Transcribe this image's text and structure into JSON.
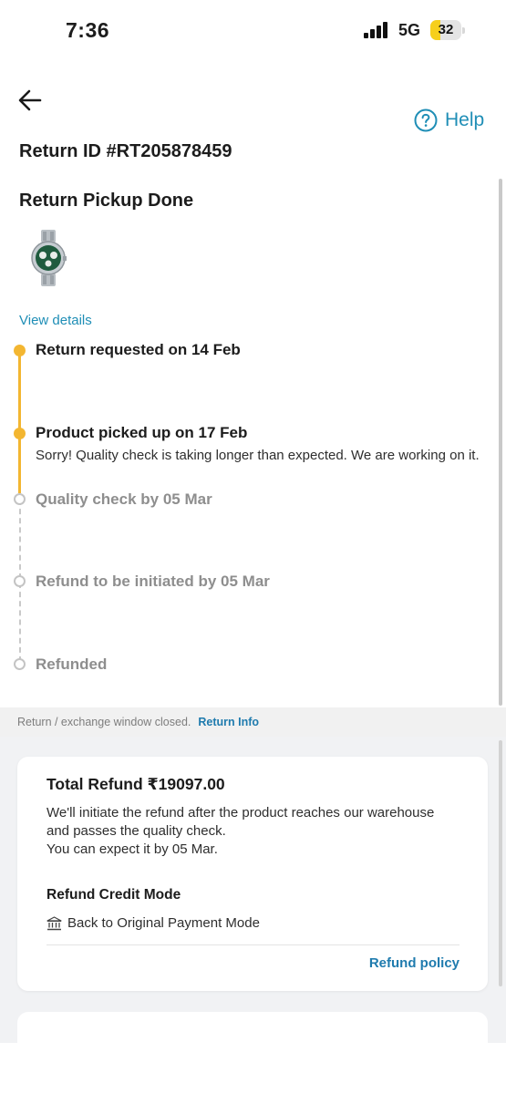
{
  "status_bar": {
    "time": "7:36",
    "network": "5G",
    "battery_level": "32",
    "battery_fraction": 0.32
  },
  "header": {
    "help_label": "Help"
  },
  "return": {
    "id": "Return ID #RT205878459",
    "status": "Return Pickup Done",
    "view_details_label": "View details"
  },
  "timeline": [
    {
      "label": "Return requested on 14 Feb",
      "state": "done"
    },
    {
      "label": "Product picked up on 17 Feb",
      "state": "done",
      "note": "Sorry! Quality check is taking longer than expected. We are working on it."
    },
    {
      "label": "Quality check by 05 Mar",
      "state": "pending"
    },
    {
      "label": "Refund to be initiated by 05 Mar",
      "state": "pending"
    },
    {
      "label": "Refunded",
      "state": "pending"
    }
  ],
  "window_notice": {
    "text": "Return / exchange window closed.",
    "link": "Return Info"
  },
  "refund_card": {
    "title": "Total Refund ₹19097.00",
    "desc_line1": "We'll initiate the refund after the product reaches our warehouse",
    "desc_line2": "and passes the quality check.",
    "desc_line3": "You can expect it by 05 Mar.",
    "mode_label": "Refund Credit Mode",
    "mode_value": "Back to Original Payment Mode",
    "policy_link": "Refund policy"
  },
  "colors": {
    "accent": "#1f8eb6",
    "timeline_done": "#f3b631",
    "timeline_pending": "#c4c4c4",
    "battery": "#f6cf1c"
  },
  "icons": {
    "back": "back-arrow-icon",
    "help": "help-circle-icon",
    "bank": "bank-icon",
    "product": "watch-thumbnail"
  }
}
